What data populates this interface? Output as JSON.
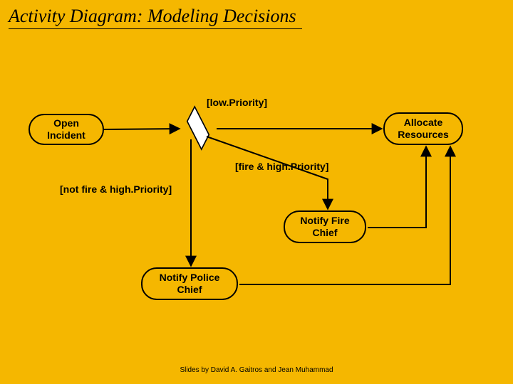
{
  "title": "Activity Diagram: Modeling Decisions",
  "footer": "Slides by David A. Gaitros and Jean Muhammad",
  "nodes": {
    "open_incident": "Open\nIncident",
    "allocate_resources": "Allocate\nResources",
    "notify_fire_chief": "Notify\nFire Chief",
    "notify_police_chief": "Notify\nPolice Chief"
  },
  "guards": {
    "low_priority": "[low.Priority]",
    "fire_high": "[fire & high.Priority]",
    "not_fire_high": "[not fire & high.Priority]"
  }
}
